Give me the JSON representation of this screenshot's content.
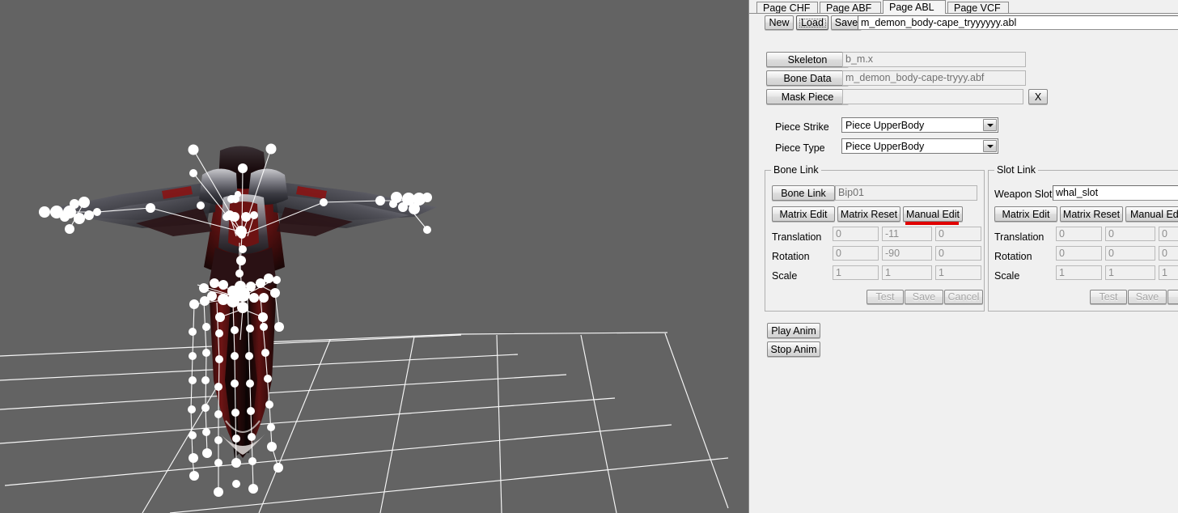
{
  "window": {
    "viewport_bg": "#636363",
    "panel_bg": "#f0f0f0",
    "accent_red": "#e00000"
  },
  "tabs": [
    {
      "label": "Page CHF",
      "selected": false
    },
    {
      "label": "Page ABF",
      "selected": false
    },
    {
      "label": "Page ABL",
      "selected": true
    },
    {
      "label": "Page VCF",
      "selected": false
    }
  ],
  "filebar": {
    "new_label": "New",
    "load_label": "Load",
    "save_label": "Save",
    "filename": "m_demon_body-cape_tryyyyyy.abl"
  },
  "assets": {
    "skeleton_label": "Skeleton",
    "skeleton_value": "b_m.x",
    "bone_data_label": "Bone Data",
    "bone_data_value": "m_demon_body-cape-tryyy.abf",
    "mask_piece_label": "Mask Piece",
    "mask_piece_value": "",
    "clear_label": "X"
  },
  "piece": {
    "strike_label": "Piece Strike",
    "strike_value": "Piece UpperBody",
    "type_label": "Piece Type",
    "type_value": "Piece UpperBody"
  },
  "bone_link": {
    "title": "Bone Link",
    "button_label": "Bone Link",
    "value": "Bip01",
    "matrix_edit": "Matrix Edit",
    "matrix_reset": "Matrix Reset",
    "manual_edit": "Manual Edit",
    "manual_edit_highlighted": true,
    "rows": [
      {
        "label": "Translation",
        "x": "0",
        "y": "-11",
        "z": "0"
      },
      {
        "label": "Rotation",
        "x": "0",
        "y": "-90",
        "z": "0"
      },
      {
        "label": "Scale",
        "x": "1",
        "y": "1",
        "z": "1"
      }
    ],
    "test_label": "Test",
    "save_label": "Save",
    "cancel_label": "Cancel"
  },
  "slot_link": {
    "title": "Slot Link",
    "weapon_slot_label": "Weapon Slot",
    "weapon_slot_value": "whal_slot",
    "matrix_edit": "Matrix Edit",
    "matrix_reset": "Matrix Reset",
    "manual_edit": "Manual Edit",
    "rows": [
      {
        "label": "Translation",
        "x": "0",
        "y": "0",
        "z": "0"
      },
      {
        "label": "Rotation",
        "x": "0",
        "y": "0",
        "z": "0"
      },
      {
        "label": "Scale",
        "x": "1",
        "y": "1",
        "z": "1"
      }
    ],
    "test_label": "Test",
    "save_label": "Save",
    "cancel_label": "C"
  },
  "anim": {
    "play_label": "Play Anim",
    "stop_label": "Stop Anim"
  },
  "viewport": {
    "description": "3D model preview of an armored demon character with cape, shown from behind with skeleton bone joints overlaid as white spheres and lines, standing on a white wireframe ground grid"
  }
}
